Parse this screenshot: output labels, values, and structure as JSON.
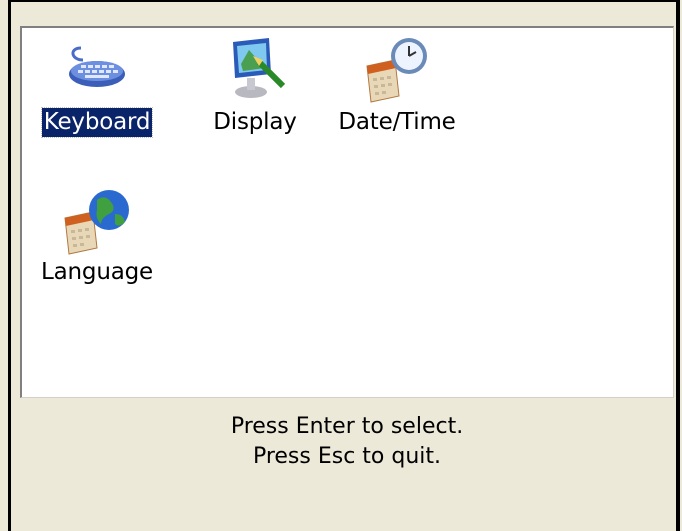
{
  "items": [
    {
      "label": "Keyboard",
      "icon": "keyboard-icon",
      "selected": true
    },
    {
      "label": "Display",
      "icon": "display-icon",
      "selected": false
    },
    {
      "label": "Date/Time",
      "icon": "clock-calendar-icon",
      "selected": false
    },
    {
      "label": "Language",
      "icon": "globe-calendar-icon",
      "selected": false
    }
  ],
  "status": {
    "line1": "Press Enter to select.",
    "line2": "Press Esc to quit."
  },
  "colors": {
    "selection": "#0a246a",
    "panel": "#ffffff",
    "chrome": "#ece9d8"
  }
}
